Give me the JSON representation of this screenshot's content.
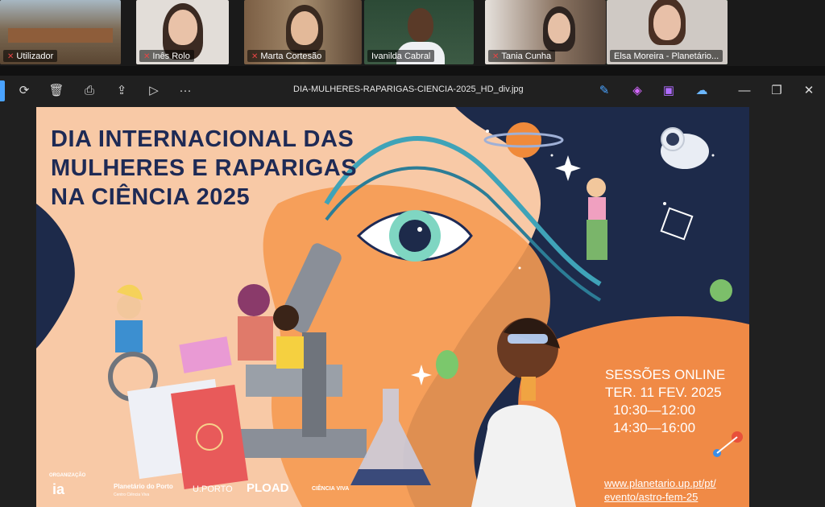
{
  "participants": [
    {
      "name": "Utilizador",
      "muted": true,
      "bg": "#6b5a45"
    },
    {
      "name": "Inês Rolo",
      "muted": true,
      "bg": "#d9d4cf"
    },
    {
      "name": "Marta Cortesão",
      "muted": true,
      "bg": "#8a6f52"
    },
    {
      "name": "Ivanilda Cabral",
      "muted": false,
      "bg": "#2f4a38"
    },
    {
      "name": "Tania Cunha",
      "muted": true,
      "bg": "#7a6a5a"
    },
    {
      "name": "Elsa Moreira - Planetário...",
      "muted": false,
      "bg": "#c9c3bf",
      "active": true
    }
  ],
  "viewer": {
    "file_name": "DIA-MULHERES-RAPARIGAS-CIENCIA-2025_HD_div.jpg",
    "toolbar_icons": [
      "rotate-icon",
      "delete-icon",
      "print-icon",
      "share-icon",
      "slideshow-icon",
      "more-icon"
    ],
    "right_icons": [
      "edit-icon",
      "copilot-icon",
      "clipchamp-icon",
      "onedrive-icon"
    ],
    "window_controls": {
      "minimize": "—",
      "restore": "❐",
      "close": "✕"
    }
  },
  "poster": {
    "title_lines": [
      "DIA INTERNACIONAL DAS",
      "MULHERES E RAPARIGAS",
      "NA CIÊNCIA 2025"
    ],
    "sessions_heading": "SESSÕES ONLINE",
    "date": "TER. 11 FEV. 2025",
    "times": [
      "10:30—12:00",
      "14:30—16:00"
    ],
    "url_lines": [
      "www.planetario.up.pt/pt/",
      "evento/astro-fem-25"
    ],
    "logos": {
      "label": "ORGANIZAÇÃO",
      "ia": "ia",
      "planetario": "Planetário do Porto",
      "planetario_sub": "Centro Ciência Viva",
      "uporto": "U.PORTO",
      "pload": "PLOAD",
      "cienciaviva": "CIÊNCIA VIVA"
    },
    "colors": {
      "navy": "#1e2a55",
      "orange": "#f59a52",
      "peach": "#f8c9a6",
      "space": "#1d2a4a"
    }
  }
}
